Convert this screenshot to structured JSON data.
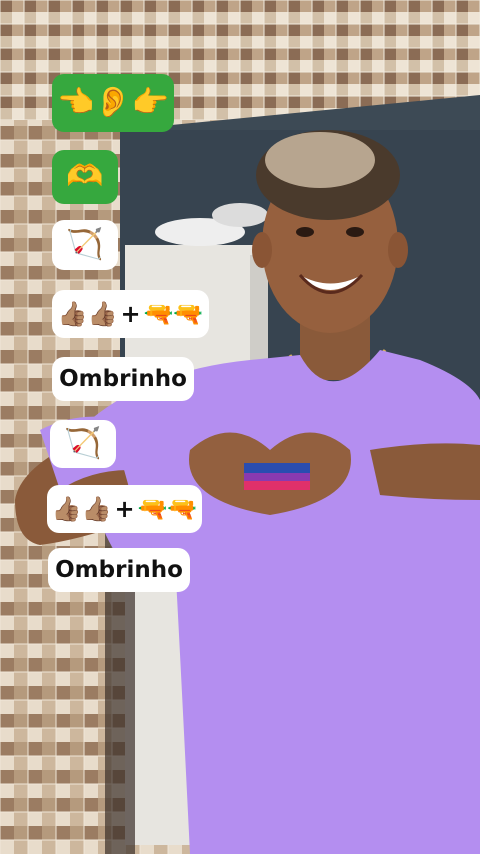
{
  "colors": {
    "overlay_green": "#36a83e",
    "overlay_white": "#ffffff",
    "shirt": "#b48ef0"
  },
  "captions": [
    {
      "style": "green",
      "emoji": "👈👂👉"
    },
    {
      "style": "green",
      "emoji": "🫶"
    },
    {
      "style": "white",
      "emoji": "🏹"
    },
    {
      "style": "white",
      "left_emoji": "👍🏽👍🏽",
      "plus": "+",
      "right_emoji": "🔫🔫"
    },
    {
      "style": "white",
      "text": "Ombrinho"
    },
    {
      "style": "white",
      "emoji": "🏹"
    },
    {
      "style": "white",
      "left_emoji": "👍🏽👍🏽",
      "plus": "+",
      "right_emoji": "🔫🔫"
    },
    {
      "style": "white",
      "text": "Ombrinho"
    }
  ]
}
